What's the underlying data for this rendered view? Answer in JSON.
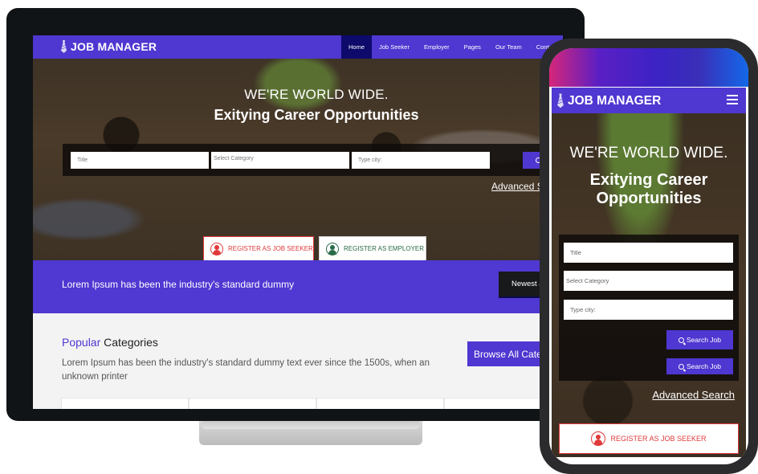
{
  "brand": {
    "name": "JOB MANAGER",
    "primary_color": "#4f37d1",
    "nav_active_color": "#0d0a6b",
    "danger_color": "#e03a3a",
    "success_color": "#2a6b47"
  },
  "desktop": {
    "nav": {
      "items": [
        {
          "label": "Home",
          "active": true
        },
        {
          "label": "Job Seeker",
          "active": false
        },
        {
          "label": "Employer",
          "active": false
        },
        {
          "label": "Pages",
          "active": false
        },
        {
          "label": "Our Team",
          "active": false
        },
        {
          "label": "Contact Us",
          "active": false
        }
      ]
    },
    "hero": {
      "title": "WE'RE WORLD WIDE.",
      "subtitle": "Exitying Career Opportunities"
    },
    "search": {
      "title_placeholder": "Title",
      "category_placeholder": "Select Category",
      "city_placeholder": "Type city:",
      "button_label": "Search Job",
      "advanced_link": "Advanced Search"
    },
    "register": {
      "seeker_label": "REGISTER AS JOB SEEKER",
      "employer_label": "REGISTER AS EMPLOYER"
    },
    "band": {
      "text": "Lorem Ipsum has been the industry's standard dummy",
      "button_label": "Newest Jobs"
    },
    "categories": {
      "title_accent": "Popular",
      "title_rest": "Categories",
      "description": "Lorem Ipsum has been the industry's standard dummy text ever since the 1500s, when an unknown printer",
      "browse_label": "Browse All Categories"
    }
  },
  "mobile": {
    "menu_icon": "hamburger-icon",
    "hero": {
      "title": "WE'RE WORLD WIDE.",
      "subtitle": "Exitying Career Opportunities"
    },
    "search": {
      "title_placeholder": "Title",
      "category_placeholder": "Select Category",
      "city_placeholder": "Type city:",
      "button_label_1": "Search Job",
      "button_label_2": "Search Job",
      "advanced_link": "Advanced Search"
    },
    "register": {
      "seeker_label": "REGISTER AS JOB SEEKER"
    }
  }
}
